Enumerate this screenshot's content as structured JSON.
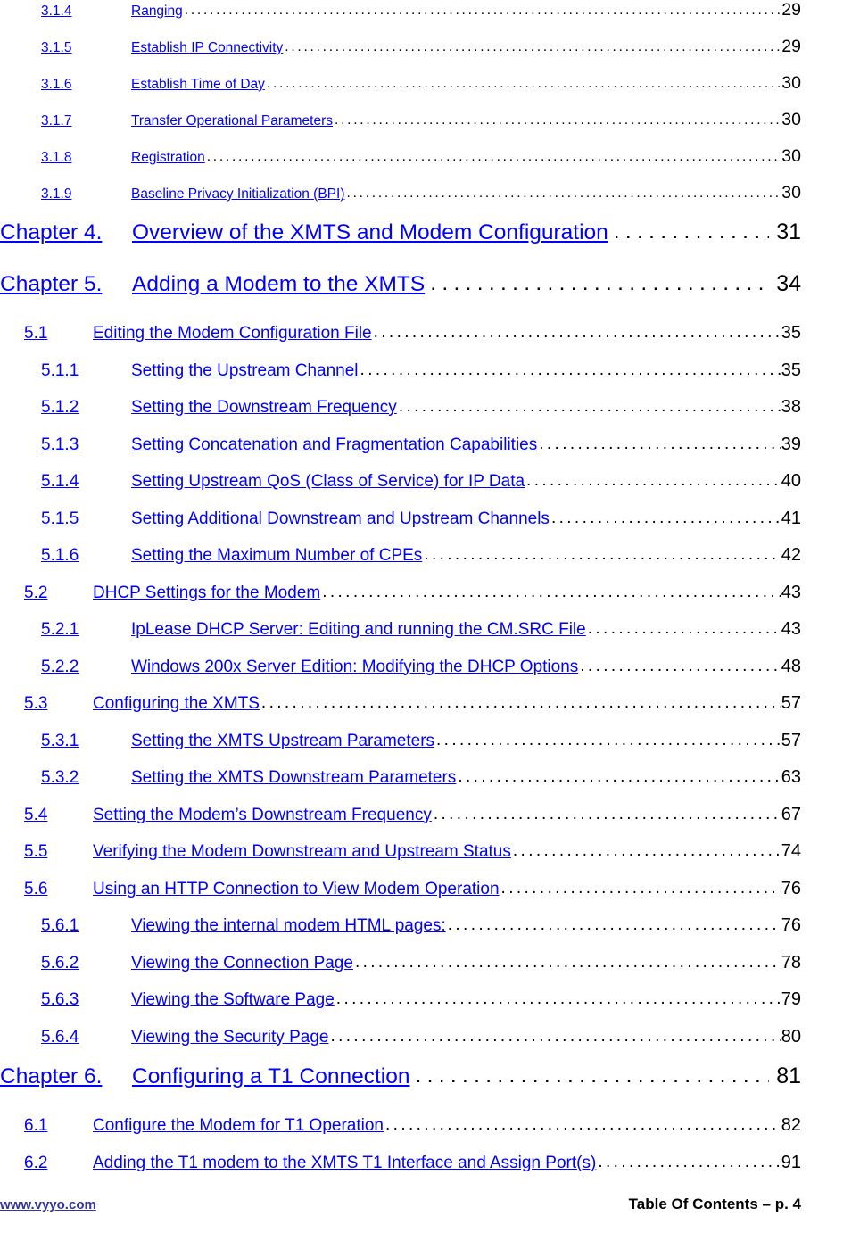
{
  "document": {
    "type": "table-of-contents",
    "page_label": "Table Of Contents – p. 4",
    "link_color": "#0000ff",
    "page_number_color": "#000000",
    "footer_link_color": "#333399"
  },
  "entries": [
    {
      "level": 3,
      "size": "small",
      "number": "3.1.4",
      "title": "Ranging",
      "page": "29"
    },
    {
      "level": 3,
      "size": "small",
      "number": "3.1.5",
      "title": "Establish IP Connectivity",
      "page": "29"
    },
    {
      "level": 3,
      "size": "small",
      "number": "3.1.6",
      "title": "Establish Time of Day",
      "page": "30"
    },
    {
      "level": 3,
      "size": "small",
      "number": "3.1.7",
      "title": "Transfer Operational Parameters",
      "page": "30"
    },
    {
      "level": 3,
      "size": "small",
      "number": "3.1.8",
      "title": "Registration",
      "page": "30"
    },
    {
      "level": 3,
      "size": "small",
      "number": "3.1.9",
      "title": "Baseline Privacy Initialization (BPI)",
      "page": "30"
    },
    {
      "level": 1,
      "size": "chapter",
      "number": "Chapter 4.",
      "title": "Overview of the XMTS and Modem Configuration",
      "page": "31"
    },
    {
      "level": 1,
      "size": "chapter",
      "number": "Chapter 5.",
      "title": "Adding a Modem to the XMTS",
      "page": "34"
    },
    {
      "level": 2,
      "size": "normal",
      "number": "5.1",
      "title": "Editing the Modem Configuration File",
      "page": "35"
    },
    {
      "level": 3,
      "size": "normal",
      "number": "5.1.1",
      "title": "Setting the Upstream Channel",
      "page": "35"
    },
    {
      "level": 3,
      "size": "normal",
      "number": "5.1.2",
      "title": "Setting the Downstream Frequency",
      "page": "38"
    },
    {
      "level": 3,
      "size": "normal",
      "number": "5.1.3",
      "title": "Setting Concatenation and Fragmentation Capabilities",
      "page": "39"
    },
    {
      "level": 3,
      "size": "normal",
      "number": "5.1.4",
      "title": "Setting Upstream QoS (Class of Service) for IP Data",
      "page": "40"
    },
    {
      "level": 3,
      "size": "normal",
      "number": "5.1.5",
      "title": "Setting Additional Downstream and Upstream Channels",
      "page": "41"
    },
    {
      "level": 3,
      "size": "normal",
      "number": "5.1.6",
      "title": "Setting the Maximum Number of CPEs",
      "page": "42"
    },
    {
      "level": 2,
      "size": "normal",
      "number": "5.2",
      "title": "DHCP Settings for the Modem",
      "page": "43"
    },
    {
      "level": 3,
      "size": "normal",
      "number": "5.2.1",
      "title": "IpLease DHCP Server: Editing and running the CM.SRC File",
      "page": "43"
    },
    {
      "level": 3,
      "size": "normal",
      "number": "5.2.2",
      "title": "Windows 200x Server Edition: Modifying the  DHCP Options",
      "page": "48"
    },
    {
      "level": 2,
      "size": "normal",
      "number": "5.3",
      "title": "Configuring the XMTS",
      "page": "57"
    },
    {
      "level": 3,
      "size": "normal",
      "number": "5.3.1",
      "title": "Setting the XMTS Upstream Parameters",
      "page": "57"
    },
    {
      "level": 3,
      "size": "normal",
      "number": "5.3.2",
      "title": "Setting the XMTS Downstream Parameters",
      "page": "63"
    },
    {
      "level": 2,
      "size": "normal",
      "number": "5.4",
      "title": "Setting the Modem’s Downstream Frequency",
      "page": "67"
    },
    {
      "level": 2,
      "size": "normal",
      "number": "5.5",
      "title": "Verifying the Modem Downstream and Upstream Status",
      "page": "74"
    },
    {
      "level": 2,
      "size": "normal",
      "number": "5.6",
      "title": "Using an HTTP Connection to View Modem Operation",
      "page": "76"
    },
    {
      "level": 3,
      "size": "normal",
      "number": "5.6.1",
      "title": "Viewing the internal modem HTML pages:",
      "page": "76"
    },
    {
      "level": 3,
      "size": "normal",
      "number": "5.6.2",
      "title": "Viewing the Connection Page",
      "page": "78"
    },
    {
      "level": 3,
      "size": "normal",
      "number": "5.6.3",
      "title": "Viewing the Software Page",
      "page": "79"
    },
    {
      "level": 3,
      "size": "normal",
      "number": "5.6.4",
      "title": "Viewing the Security Page",
      "page": "80"
    },
    {
      "level": 1,
      "size": "chapter",
      "number": "Chapter 6.",
      "title": "Configuring a T1 Connection",
      "page": "81"
    },
    {
      "level": 2,
      "size": "normal",
      "number": "6.1",
      "title": "Configure the Modem for T1 Operation",
      "page": "82"
    },
    {
      "level": 2,
      "size": "normal",
      "number": "6.2",
      "title": "Adding the T1 modem to the XMTS T1 Interface and Assign Port(s)",
      "page": "91"
    }
  ],
  "footer": {
    "website": "www.vyyo.com",
    "page_label": "Table Of Contents – p. 4"
  }
}
